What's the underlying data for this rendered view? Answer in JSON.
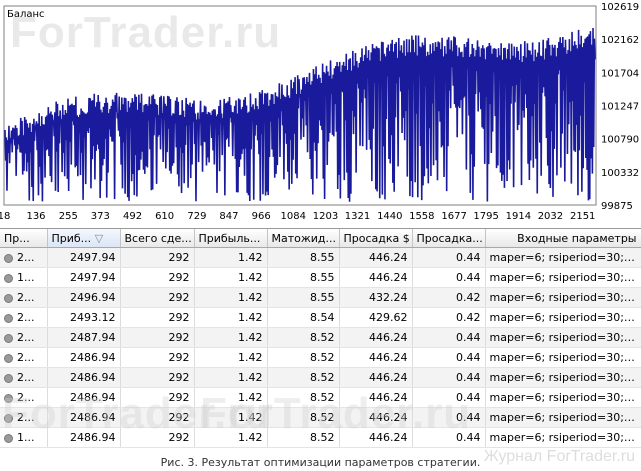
{
  "chart": {
    "label": "Баланс",
    "watermark": "ForTrader.ru",
    "line_color": "#1a1a9c"
  },
  "chart_data": {
    "type": "line",
    "title": "Баланс",
    "x_ticks": [
      "18",
      "136",
      "255",
      "373",
      "492",
      "610",
      "729",
      "847",
      "966",
      "1084",
      "1203",
      "1321",
      "1440",
      "1558",
      "1677",
      "1795",
      "1914",
      "2032",
      "2151"
    ],
    "y_ticks": [
      "102619",
      "102162",
      "101704",
      "101247",
      "100790",
      "100332",
      "99875"
    ],
    "xlim": [
      18,
      2200
    ],
    "ylim": [
      99875,
      102619
    ],
    "series": [
      {
        "values": []
      }
    ]
  },
  "table": {
    "headers": [
      "Пр...",
      "Приб...",
      "Всего сде...",
      "Прибыль...",
      "Матожид...",
      "Просадка $",
      "Просадка...",
      "Входные параметры"
    ],
    "sort_column": 1,
    "sort_icon": "▽",
    "rows": [
      [
        "2...",
        "2497.94",
        "292",
        "1.42",
        "8.55",
        "446.24",
        "0.44",
        "maper=6; rsiperiod=30; b..."
      ],
      [
        "1...",
        "2497.94",
        "292",
        "1.42",
        "8.55",
        "446.24",
        "0.44",
        "maper=6; rsiperiod=30; b..."
      ],
      [
        "2...",
        "2496.94",
        "292",
        "1.42",
        "8.55",
        "432.24",
        "0.42",
        "maper=6; rsiperiod=30; b..."
      ],
      [
        "2...",
        "2493.12",
        "292",
        "1.42",
        "8.54",
        "429.62",
        "0.42",
        "maper=6; rsiperiod=30; b..."
      ],
      [
        "2...",
        "2487.94",
        "292",
        "1.42",
        "8.52",
        "446.24",
        "0.44",
        "maper=6; rsiperiod=30; b..."
      ],
      [
        "2...",
        "2486.94",
        "292",
        "1.42",
        "8.52",
        "446.24",
        "0.44",
        "maper=6; rsiperiod=30; b..."
      ],
      [
        "2...",
        "2486.94",
        "292",
        "1.42",
        "8.52",
        "446.24",
        "0.44",
        "maper=6; rsiperiod=30; b..."
      ],
      [
        "2...",
        "2486.94",
        "292",
        "1.42",
        "8.52",
        "446.24",
        "0.44",
        "maper=6; rsiperiod=30; b..."
      ],
      [
        "2...",
        "2486.94",
        "292",
        "1.42",
        "8.52",
        "446.24",
        "0.44",
        "maper=6; rsiperiod=30; b..."
      ],
      [
        "1...",
        "2486.94",
        "292",
        "1.42",
        "8.52",
        "446.24",
        "0.44",
        "maper=6; rsiperiod=30; b..."
      ]
    ]
  },
  "caption": "Рис. 3. Результат оптимизации параметров стратегии.",
  "credit": "Журнал ForTrader.ru"
}
